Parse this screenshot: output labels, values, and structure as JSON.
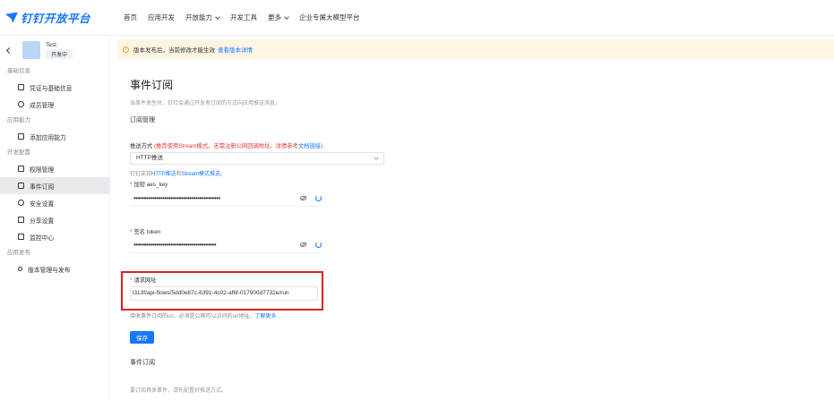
{
  "topnav": {
    "brand": "钉钉开放平台",
    "items": [
      "首页",
      "应用开发",
      "开放能力",
      "开发工具",
      "更多",
      "企业专属大模型平台"
    ]
  },
  "sidebar": {
    "app_name": "Test",
    "app_status": "开发中",
    "sections": {
      "basic": "基础信息",
      "ability": "应用能力",
      "config": "开发配置",
      "publish": "应用发布"
    },
    "items": {
      "credentials": "凭证与基础信息",
      "members": "成员管理",
      "add_ability": "添加应用能力",
      "permissions": "权限管理",
      "events": "事件订阅",
      "security": "安全设置",
      "share": "分享设置",
      "monitor": "监控中心",
      "versions": "版本管理与发布"
    }
  },
  "notice": {
    "text": "版本发布后，当前修改才能生效",
    "link": "查看版本详情"
  },
  "main": {
    "title": "事件订阅",
    "desc": "当事件发生时，钉钉会通过开发者订阅的方式向应用推送消息。",
    "section_manage": "订阅管理",
    "push_label": "推送方式",
    "push_hint": "(推荐使用Stream模式，无需注册公网回调地址，详情参考",
    "push_hint_link": "文档链接",
    "push_hint_end": ")",
    "push_value": "HTTP推送",
    "push_sub_hint": "钉钉支持",
    "push_sub_link1": "HTTP推送",
    "push_sub_and": "和",
    "push_sub_link2": "Stream模式推送",
    "push_sub_end": "。",
    "aes_label": "加密 aes_key",
    "aes_value": "••••••••••••••••••••••••••••••••••••••••••",
    "token_label": "签名 token",
    "token_value": "••••••••••••••••••••••••••••••••••••••••",
    "url_label": "请求网址",
    "url_value": "l313f/api-flows/5dd0e87c-6391-4c02-af6f-017900d7732e/run",
    "url_hint": "接收事件订阅的url，必须是公网可以访问的url地址。",
    "url_hint_link": "了解更多",
    "save": "保存",
    "section_events": "事件订阅",
    "events_desc": "要订阅具体事件，请先配置好推送方式。"
  }
}
